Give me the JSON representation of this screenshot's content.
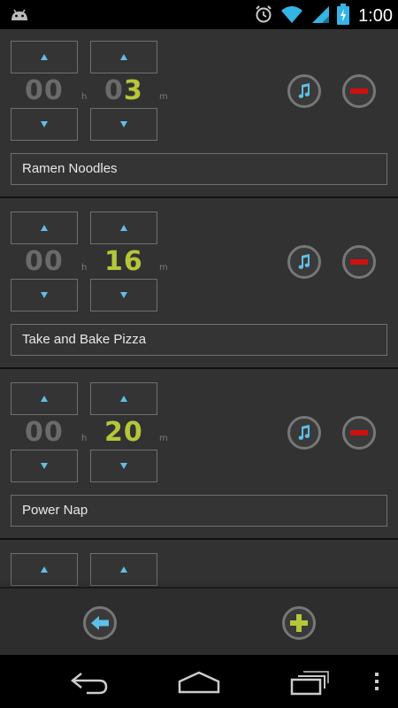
{
  "status_bar": {
    "time": "1:00",
    "icons": [
      "android-debug-icon",
      "alarm-icon",
      "wifi-icon",
      "signal-icon",
      "battery-charging-icon"
    ]
  },
  "timers": [
    {
      "hours": "00",
      "minutes_lead": "0",
      "minutes_active": "3",
      "hour_unit": "h",
      "minute_unit": "m",
      "name": "Ramen Noodles"
    },
    {
      "hours": "00",
      "minutes_lead": "",
      "minutes_active": "16",
      "hour_unit": "h",
      "minute_unit": "m",
      "name": "Take and Bake Pizza"
    },
    {
      "hours": "00",
      "minutes_lead": "",
      "minutes_active": "20",
      "hour_unit": "h",
      "minute_unit": "m",
      "name": "Power Nap"
    },
    {
      "hours": "",
      "minutes_lead": "",
      "minutes_active": "",
      "hour_unit": "",
      "minute_unit": "",
      "name": ""
    }
  ],
  "bottom_bar": {
    "icons": [
      "back-arrow-icon",
      "add-icon"
    ]
  },
  "nav_bar": {
    "icons": [
      "nav-back-icon",
      "nav-home-icon",
      "nav-recent-apps-icon",
      "nav-menu-icon"
    ]
  },
  "colors": {
    "accent_blue": "#5fbfe8",
    "active_digits": "#b6c63a",
    "inactive_digits": "#6a6a6a",
    "remove_red": "#d01010",
    "add_green": "#b6c63a",
    "background": "#323232"
  }
}
